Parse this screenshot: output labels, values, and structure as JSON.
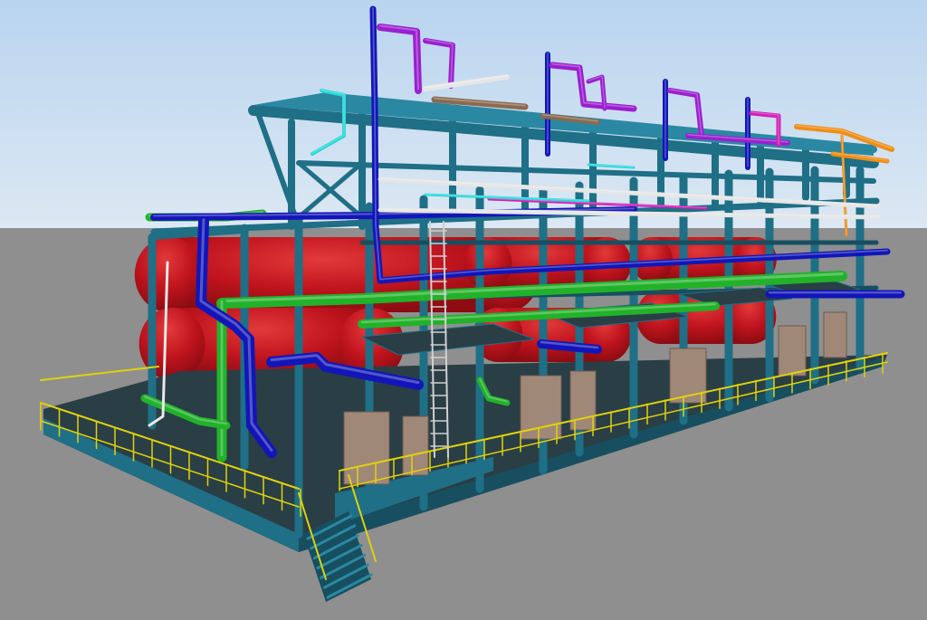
{
  "scene": {
    "colors": {
      "sky_top": "#b9d4ef",
      "sky_bottom": "#dce8f3",
      "ground": "#8f8f8f",
      "steel": "#1f6f86",
      "steel_dark": "#174f60",
      "steel_light": "#2b88a2",
      "vessel": "#c0141e",
      "vessel_dark": "#8c0c12",
      "vessel_light": "#e23a3a",
      "pipe_green": "#22b22a",
      "pipe_blue": "#1216b8",
      "pipe_purple": "#9b1fd0",
      "pipe_magenta": "#d21fb8",
      "pipe_orange": "#ef8e16",
      "pipe_cyan": "#2bd9d9",
      "pipe_white": "#e6e6e6",
      "pipe_brown": "#8a6a50",
      "handrail": "#e0d20a",
      "deck": "#2a3e46",
      "equipment": "#a08878"
    }
  }
}
